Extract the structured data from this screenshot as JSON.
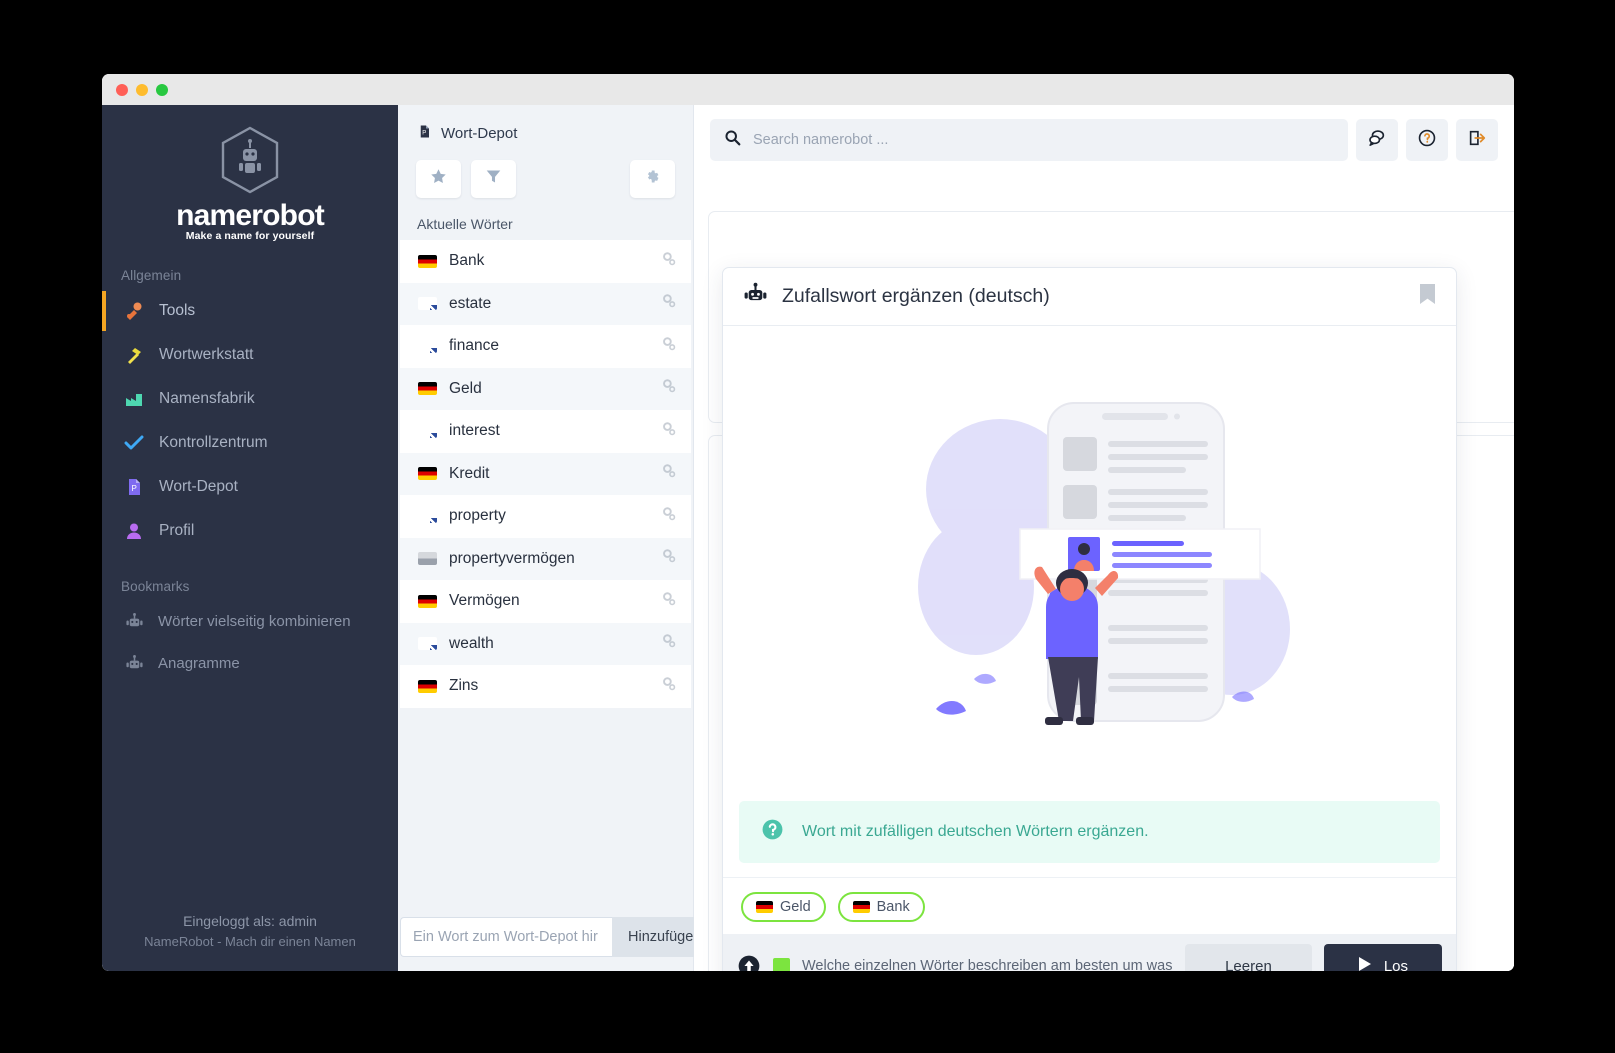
{
  "window": {
    "traffic_lights": [
      "close",
      "minimize",
      "maximize"
    ]
  },
  "sidebar": {
    "brand": "namerobot",
    "tagline": "Make a name for yourself",
    "section_general": "Allgemein",
    "items": [
      {
        "label": "Tools",
        "icon": "tools-icon",
        "active": true
      },
      {
        "label": "Wortwerkstatt",
        "icon": "hammer-icon",
        "active": false
      },
      {
        "label": "Namensfabrik",
        "icon": "factory-icon",
        "active": false
      },
      {
        "label": "Kontrollzentrum",
        "icon": "check-icon",
        "active": false
      },
      {
        "label": "Wort-Depot",
        "icon": "document-icon",
        "active": false
      },
      {
        "label": "Profil",
        "icon": "user-icon",
        "active": false
      }
    ],
    "section_bookmarks": "Bookmarks",
    "bookmarks": [
      {
        "label": "Wörter vielseitig kombinieren",
        "icon": "robot-icon"
      },
      {
        "label": "Anagramme",
        "icon": "robot-icon"
      }
    ],
    "footer_user": "Eingeloggt als: admin",
    "footer_tag": "NameRobot - Mach dir einen Namen"
  },
  "wordpanel": {
    "title": "Wort-Depot",
    "toolbar": [
      {
        "name": "favorites-button",
        "icon": "star-icon"
      },
      {
        "name": "filter-button",
        "icon": "filter-icon"
      },
      {
        "name": "settings-button",
        "icon": "gear-icon"
      }
    ],
    "subtitle": "Aktuelle Wörter",
    "words": [
      {
        "label": "Bank",
        "lang": "de"
      },
      {
        "label": "estate",
        "lang": "en"
      },
      {
        "label": "finance",
        "lang": "en"
      },
      {
        "label": "Geld",
        "lang": "de"
      },
      {
        "label": "interest",
        "lang": "en"
      },
      {
        "label": "Kredit",
        "lang": "de"
      },
      {
        "label": "property",
        "lang": "en"
      },
      {
        "label": "propertyvermögen",
        "lang": "none"
      },
      {
        "label": "Vermögen",
        "lang": "de"
      },
      {
        "label": "wealth",
        "lang": "en"
      },
      {
        "label": "Zins",
        "lang": "de"
      }
    ],
    "add_placeholder": "Ein Wort zum Wort-Depot hir",
    "add_button": "Hinzufügen"
  },
  "topbar": {
    "search_placeholder": "Search namerobot ...",
    "search_value": "",
    "buttons": [
      {
        "name": "chat-icon"
      },
      {
        "name": "help-icon"
      },
      {
        "name": "logout-icon"
      }
    ]
  },
  "card": {
    "title": "Zufallswort ergänzen (deutsch)",
    "icon": "robot-icon",
    "bookmark_icon": "bookmark-icon",
    "hint": "Wort mit zufälligen deutschen Wörtern ergänzen.",
    "hint_icon": "question-circle-icon",
    "chips": [
      {
        "label": "Geld",
        "lang": "de"
      },
      {
        "label": "Bank",
        "lang": "de"
      }
    ],
    "prompt_icon": "arrow-up-circle-icon",
    "prompt_text": "Welche einzelnen Wörter beschreiben am besten um was bei d",
    "clear_button": "Leeren",
    "go_button": "Los",
    "go_icon": "play-icon"
  },
  "colors": {
    "sidebar_bg": "#2b3245",
    "accent_orange": "#f5a623",
    "chip_border": "#7ce43f",
    "hint_bg": "#e8fbf5",
    "hint_text": "#3aa892"
  }
}
